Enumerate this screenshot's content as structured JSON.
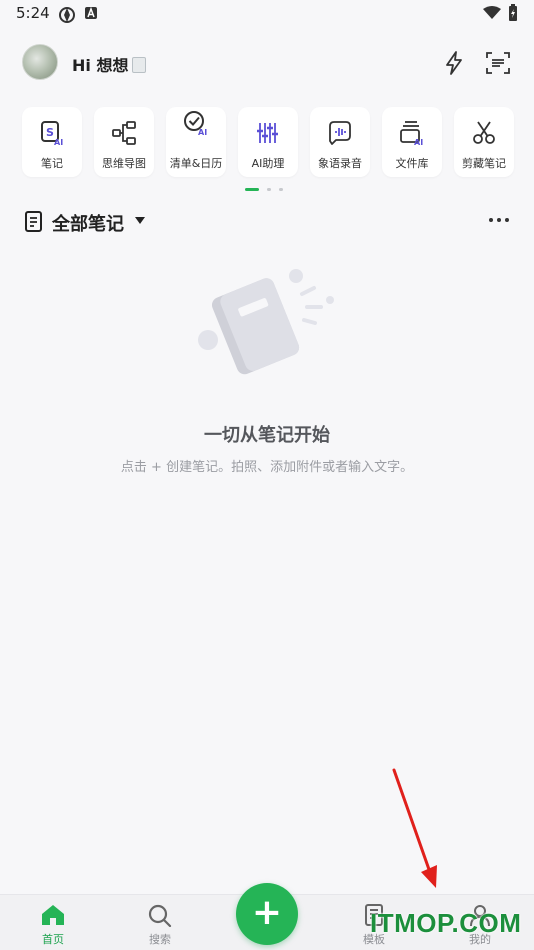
{
  "status_bar": {
    "time": "5:24"
  },
  "header": {
    "greeting": "Hi 想想"
  },
  "tools": [
    {
      "label": "笔记",
      "icon": "note-ai-icon"
    },
    {
      "label": "思维导图",
      "icon": "mindmap-icon"
    },
    {
      "label": "清单&日历",
      "icon": "checklist-ai-icon"
    },
    {
      "label": "AI助理",
      "icon": "ai-assistant-icon"
    },
    {
      "label": "象语录音",
      "icon": "voice-record-icon"
    },
    {
      "label": "文件库",
      "icon": "file-library-icon"
    },
    {
      "label": "剪藏笔记",
      "icon": "clip-icon"
    }
  ],
  "section": {
    "title": "全部笔记"
  },
  "empty_state": {
    "title": "一切从笔记开始",
    "subtitle": "点击 + 创建笔记。拍照、添加附件或者输入文字。"
  },
  "bottom_nav": {
    "items": [
      {
        "label": "首页",
        "icon": "home-icon",
        "active": true
      },
      {
        "label": "搜索",
        "icon": "search-icon",
        "active": false
      },
      {
        "label": "模板",
        "icon": "template-icon",
        "active": false
      },
      {
        "label": "我的",
        "icon": "profile-icon",
        "active": false
      }
    ],
    "fab_label": "+"
  },
  "watermark": "ITMOP.COM",
  "colors": {
    "accent": "#25b456",
    "ai_purple": "#5a4fd6",
    "background": "#f7f7f9"
  }
}
